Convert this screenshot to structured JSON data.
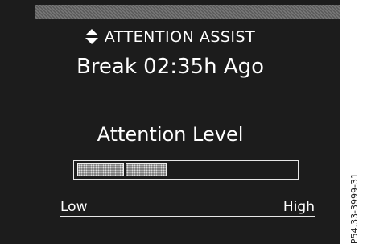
{
  "header": {
    "icon": "up-down-arrows-icon",
    "title": "ATTENTION ASSIST"
  },
  "status": {
    "break_text": "Break 02:35h Ago"
  },
  "attention_level": {
    "label": "Attention Level",
    "segments_filled": 2,
    "scale_low": "Low",
    "scale_high": "High"
  },
  "figure_code": "P54.33-3999-31",
  "colors": {
    "display_bg": "#1c1c1c",
    "text": "#ffffff"
  }
}
